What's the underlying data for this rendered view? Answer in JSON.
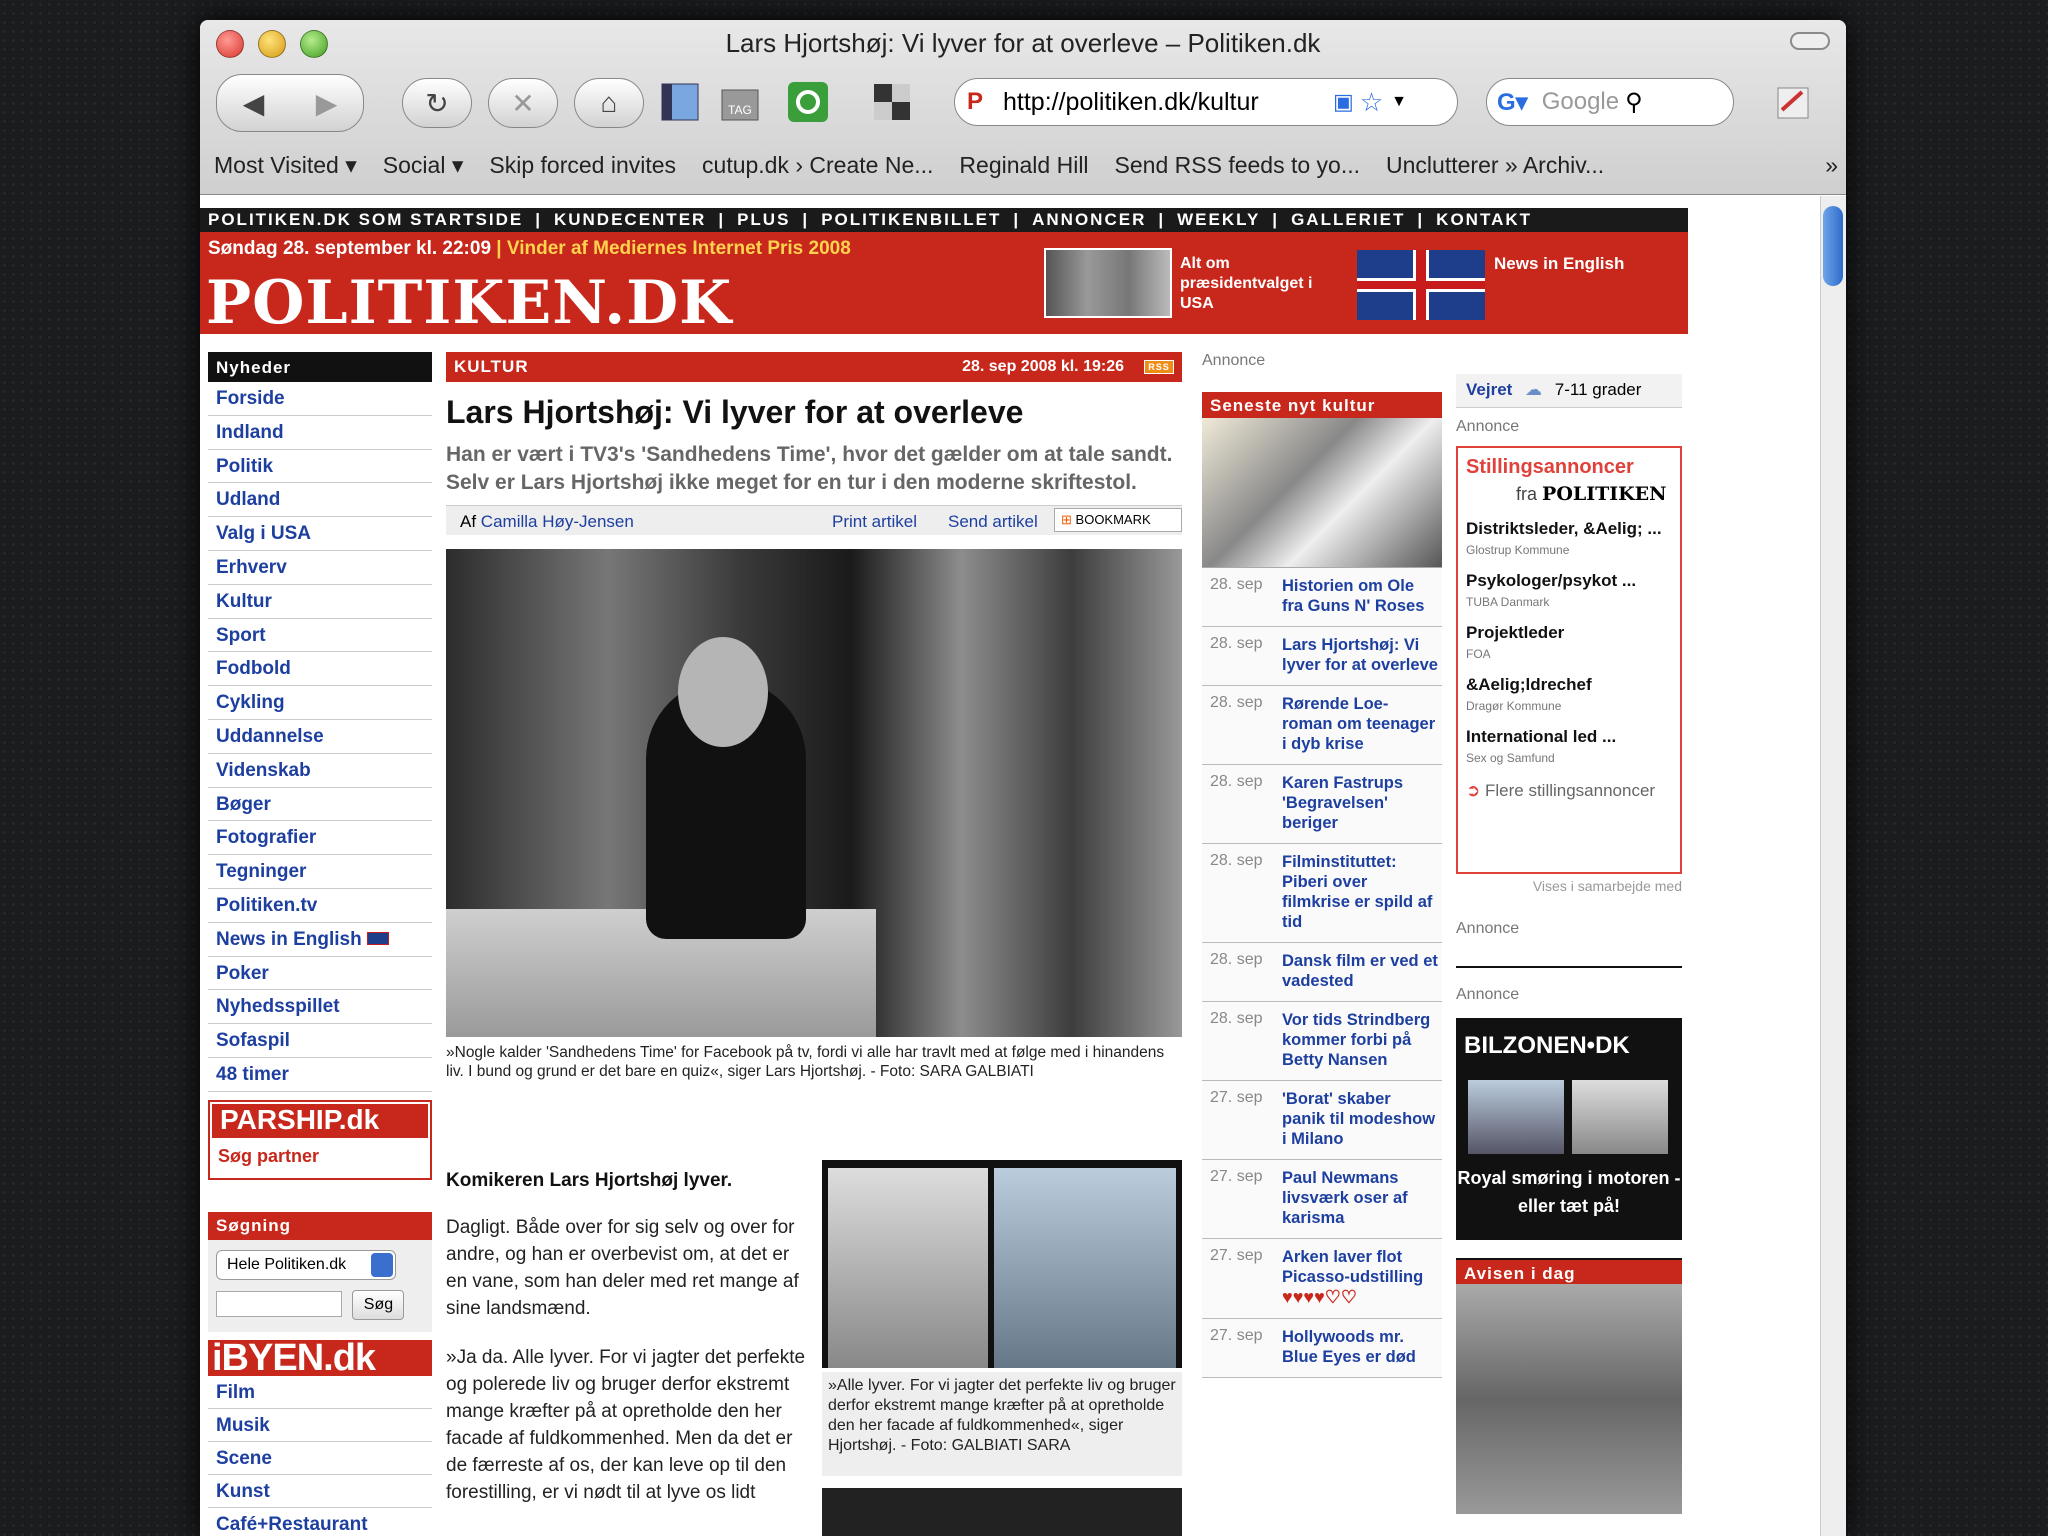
{
  "window": {
    "title": "Lars Hjortshøj: Vi lyver for at overleve – Politiken.dk",
    "url": "http://politiken.dk/kultur",
    "search_placeholder": "Google",
    "tag_label": "TAG"
  },
  "bookmarks": [
    "Most Visited ▾",
    "Social ▾",
    "Skip forced invites",
    "cutup.dk › Create Ne...",
    "Reginald Hill",
    "Send RSS feeds to yo...",
    "Unclutterer » Archiv..."
  ],
  "bookmarks_more": "»",
  "topnav": [
    "POLITIKEN.DK SOM STARTSIDE",
    "KUNDECENTER",
    "PLUS",
    "POLITIKENBILLET",
    "ANNONCER",
    "WEEKLY",
    "GALLERIET",
    "KONTAKT"
  ],
  "topnav_sep": "|",
  "brand": {
    "date": "Søndag 28. september kl. 22:09",
    "award": "| Vinder af Mediernes Internet Pris 2008",
    "logo": "POLITIKEN.DK",
    "election": "Alt om præsidentvalget i USA",
    "english": "News in English"
  },
  "left": {
    "heading": "Nyheder",
    "items": [
      "Forside",
      "Indland",
      "Politik",
      "Udland",
      "Valg i USA",
      "Erhverv",
      "Kultur",
      "Sport",
      "Fodbold",
      "Cykling",
      "Uddannelse",
      "Videnskab",
      "Bøger",
      "Fotografier",
      "Tegninger",
      "Politiken.tv",
      "News in English",
      "Poker",
      "Nyhedsspillet",
      "Sofaspil",
      "48 timer"
    ],
    "parship_logo": "PARSHIP.dk",
    "parship_cta": "Søg partner",
    "search_heading": "Søgning",
    "search_scope": "Hele Politiken.dk",
    "search_button": "Søg",
    "ibyen_logo": "iBYEN.dk",
    "ibyen_items": [
      "Film",
      "Musik",
      "Scene",
      "Kunst",
      "Café+Restaurant"
    ]
  },
  "article": {
    "section": "KULTUR",
    "date": "28. sep 2008 kl. 19:26",
    "rss": "RSS",
    "title": "Lars Hjortshøj: Vi lyver for at overleve",
    "dek": "Han er vært i TV3's 'Sandhedens Time', hvor det gælder om at tale sandt. Selv er Lars Hjortshøj ikke meget for en tur i den moderne skriftestol.",
    "by_prefix": "Af",
    "author": "Camilla Høy-Jensen",
    "print": "Print artikel",
    "send": "Send artikel",
    "bookmark": "BOOKMARK",
    "caption": "»Nogle kalder 'Sandhedens Time' for Facebook på tv, fordi vi alle har travlt med at følge med i hinandens liv. I bund og grund er det bare en quiz«, siger Lars Hjortshøj. - Foto: SARA GALBIATI",
    "lead": "Komikeren Lars Hjortshøj lyver.",
    "p1": "Dagligt. Både over for sig selv og over for andre, og han er overbevist om, at det er en vane, som han deler med ret mange af sine landsmænd.",
    "p2": "»Ja da. Alle lyver. For vi jagter det perfekte og polerede liv og bruger derfor ekstremt mange kræfter på at opretholde den her facade af fuldkommenhed. Men da det er de færreste af os, der kan leve op til den forestilling, er vi nødt til at lyve os lidt",
    "inset_caption": "»Alle lyver. For vi jagter det perfekte liv og bruger derfor ekstremt mange kræfter på at opretholde den her facade af fuldkommenhed«, siger Hjortshøj. - Foto: GALBIATI SARA"
  },
  "middle": {
    "annonce": "Annonce",
    "heading": "Seneste nyt kultur",
    "news": [
      {
        "date": "28. sep",
        "title": "Historien om Ole fra Guns N' Roses"
      },
      {
        "date": "28. sep",
        "title": "Lars Hjortshøj: Vi lyver for at overleve"
      },
      {
        "date": "28. sep",
        "title": "Rørende Loe-roman om teenager i dyb krise"
      },
      {
        "date": "28. sep",
        "title": "Karen Fastrups 'Begravelsen' beriger"
      },
      {
        "date": "28. sep",
        "title": "Filminstituttet: Piberi over filmkrise er spild af tid"
      },
      {
        "date": "28. sep",
        "title": "Dansk film er ved et vadested"
      },
      {
        "date": "28. sep",
        "title": "Vor tids Strindberg kommer forbi på Betty Nansen"
      },
      {
        "date": "27. sep",
        "title": "'Borat' skaber panik til modeshow i Milano"
      },
      {
        "date": "27. sep",
        "title": "Paul Newmans livsværk oser af karisma"
      },
      {
        "date": "27. sep",
        "title": "Arken laver flot Picasso-udstilling"
      },
      {
        "date": "27. sep",
        "title": "Hollywoods mr. Blue Eyes er død"
      }
    ],
    "rating": "♥♥♥♥♡♡"
  },
  "right": {
    "vejret_label": "Vejret",
    "vejret_value": "7-11 grader",
    "annonce": "Annonce",
    "stil_heading": "Stillingsannoncer",
    "stil_fra": "fra",
    "stil_brand": "POLITIKEN",
    "jobs": [
      {
        "title": "Distriktsleder, &Aelig; ...",
        "company": "Glostrup Kommune"
      },
      {
        "title": "Psykologer/psykot ...",
        "company": "TUBA Danmark"
      },
      {
        "title": "Projektleder",
        "company": "FOA"
      },
      {
        "title": "&Aelig;ldrechef",
        "company": "Dragør Kommune"
      },
      {
        "title": "International led ...",
        "company": "Sex og Samfund"
      }
    ],
    "flere": "Flere stillingsannoncer",
    "vises": "Vises i samarbejde med",
    "bilzonen_logo": "BILZONEN•DK",
    "bilzonen_text": "Royal smøring i motoren - eller tæt på!",
    "avisen_heading": "Avisen i dag"
  }
}
